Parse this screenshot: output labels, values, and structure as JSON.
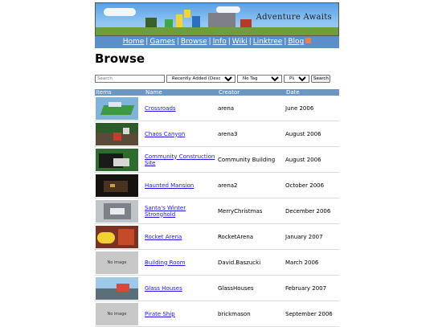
{
  "header": {
    "site_name": "Adventure Awaits",
    "nav": [
      "Home",
      "Games",
      "Browse",
      "Info",
      "Wiki",
      "Linktree",
      "Blog"
    ],
    "nav_separator": "|"
  },
  "page": {
    "title": "Browse"
  },
  "filters": {
    "search_placeholder": "Search",
    "sort": "Recently Added (Descending)",
    "tag": "No Tag",
    "type": "Places",
    "search_button": "Search"
  },
  "table": {
    "columns": [
      "Items",
      "Name",
      "Creator",
      "Date"
    ],
    "rows": [
      {
        "name": "Crossroads",
        "creator": "arena",
        "date": "June 2006",
        "thumb": "crossroads"
      },
      {
        "name": "Chaos Canyon",
        "creator": "arena3",
        "date": "August 2006",
        "thumb": "chaos-canyon"
      },
      {
        "name": "Community Construction Site",
        "creator": "Community Building",
        "date": "August 2006",
        "thumb": "construction-site"
      },
      {
        "name": "Haunted Mansion",
        "creator": "arena2",
        "date": "October 2006",
        "thumb": "haunted-mansion"
      },
      {
        "name": "Santa's Winter Stronghold",
        "creator": "MerryChristmas",
        "date": "December 2006",
        "thumb": "winter-stronghold"
      },
      {
        "name": "Rocket Arena",
        "creator": "RocketArena",
        "date": "January 2007",
        "thumb": "rocket-arena"
      },
      {
        "name": "Building Room",
        "creator": "David.Baszucki",
        "date": "March 2006",
        "thumb": "no-image"
      },
      {
        "name": "Glass Houses",
        "creator": "GlassHouses",
        "date": "February 2007",
        "thumb": "glass-houses"
      },
      {
        "name": "Pirate Ship",
        "creator": "brickmason",
        "date": "September 2006",
        "thumb": "no-image"
      }
    ],
    "no_image_label": "No image"
  },
  "colors": {
    "nav_bg": "#5b8fc9",
    "table_header_bg": "#6e96c5",
    "link": "#1a1ae0"
  }
}
